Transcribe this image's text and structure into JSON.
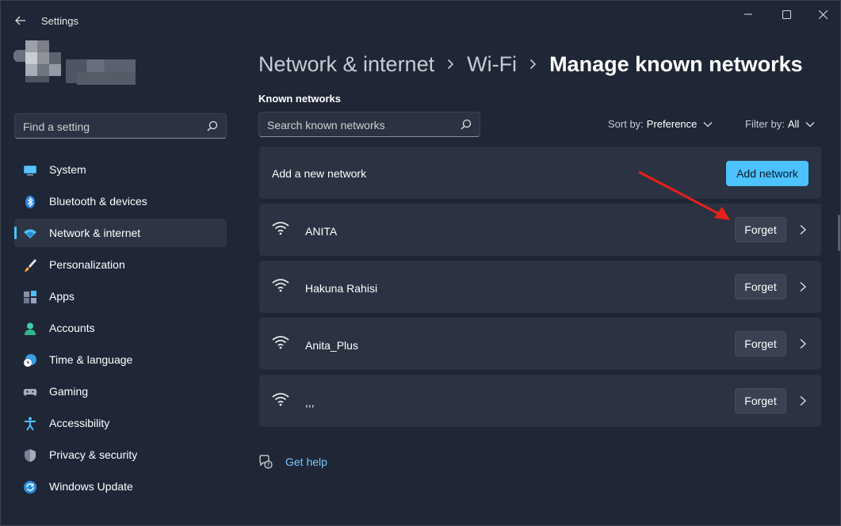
{
  "app": {
    "title": "Settings"
  },
  "sidebar": {
    "search_placeholder": "Find a setting",
    "items": [
      {
        "label": "System",
        "icon": "monitor-icon"
      },
      {
        "label": "Bluetooth & devices",
        "icon": "bluetooth-icon"
      },
      {
        "label": "Network & internet",
        "icon": "wifi-icon",
        "active": true
      },
      {
        "label": "Personalization",
        "icon": "brush-icon"
      },
      {
        "label": "Apps",
        "icon": "apps-icon"
      },
      {
        "label": "Accounts",
        "icon": "person-icon"
      },
      {
        "label": "Time & language",
        "icon": "clock-globe-icon"
      },
      {
        "label": "Gaming",
        "icon": "gamepad-icon"
      },
      {
        "label": "Accessibility",
        "icon": "accessibility-icon"
      },
      {
        "label": "Privacy & security",
        "icon": "shield-icon"
      },
      {
        "label": "Windows Update",
        "icon": "update-icon"
      }
    ]
  },
  "breadcrumb": [
    "Network & internet",
    "Wi-Fi",
    "Manage known networks"
  ],
  "main": {
    "section_title": "Known networks",
    "search_placeholder": "Search known networks",
    "sort_label": "Sort by:",
    "sort_value": "Preference",
    "filter_label": "Filter by:",
    "filter_value": "All",
    "add_row_label": "Add a new network",
    "add_button": "Add network",
    "networks": [
      {
        "name": "ANITA",
        "forget": "Forget"
      },
      {
        "name": "Hakuna Rahisi",
        "forget": "Forget"
      },
      {
        "name": "Anita_Plus",
        "forget": "Forget"
      },
      {
        "name": ",,,",
        "forget": "Forget"
      }
    ],
    "help_label": "Get help"
  },
  "colors": {
    "accent": "#4cc2ff",
    "background": "#1f2636",
    "card": "#2b3241",
    "annotation_arrow": "#e8201a"
  }
}
